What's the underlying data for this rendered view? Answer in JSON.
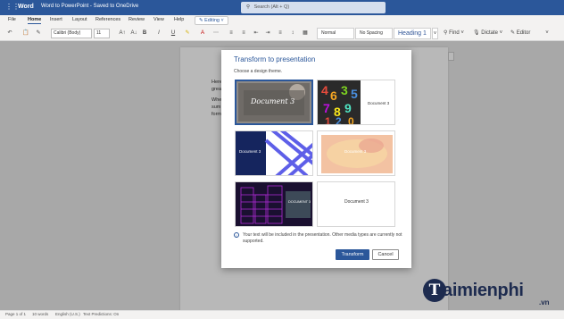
{
  "titlebar": {
    "app": "Word",
    "doc_title": "Word to PowerPoint - Saved to OneDrive",
    "search_placeholder": "Search (Alt + Q)"
  },
  "menu": {
    "tabs": [
      "File",
      "Home",
      "Insert",
      "Layout",
      "References",
      "Review",
      "View",
      "Help"
    ],
    "active": "Home",
    "editing_label": "Editing"
  },
  "ribbon": {
    "font_name": "Calibri (Body)",
    "font_size": "11",
    "bold": "B",
    "italic": "I",
    "underline": "U",
    "styles": [
      "Normal",
      "No Spacing",
      "Heading 1"
    ],
    "find": "Find",
    "dictate": "Dictate",
    "editor": "Editor"
  },
  "document": {
    "lines": [
      "Here",
      "great",
      "When",
      "sum",
      "form"
    ]
  },
  "dialog": {
    "title": "Transform to presentation",
    "subtitle": "Choose a design theme.",
    "themes": [
      {
        "label": "Document 3",
        "selected": true
      },
      {
        "label": "Document 3",
        "selected": false
      },
      {
        "label": "Document 3",
        "selected": false
      },
      {
        "label": "Document 3",
        "selected": false
      },
      {
        "label": "DOCUMENT 3",
        "selected": false
      },
      {
        "label": "Document 3",
        "selected": false
      }
    ],
    "info": "Your text will be included in the presentation. Other media types are currently not supported.",
    "transform_label": "Transform",
    "cancel_label": "Cancel"
  },
  "statusbar": {
    "page": "Page 1 of 1",
    "words": "10 words",
    "language": "English (U.S.)",
    "predictions": "Text Predictions: On"
  },
  "watermark": {
    "logo": "T",
    "name": "aimienphi",
    "suffix": ".vn"
  },
  "colors": {
    "brand": "#2b579a",
    "watermark": "#1d2b4f"
  }
}
